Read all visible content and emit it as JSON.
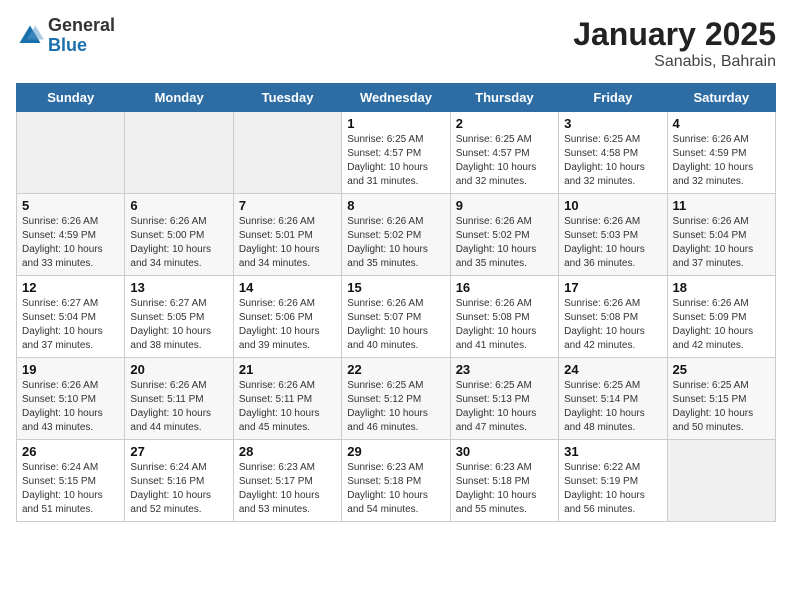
{
  "header": {
    "logo_general": "General",
    "logo_blue": "Blue",
    "title": "January 2025",
    "subtitle": "Sanabis, Bahrain"
  },
  "weekdays": [
    "Sunday",
    "Monday",
    "Tuesday",
    "Wednesday",
    "Thursday",
    "Friday",
    "Saturday"
  ],
  "weeks": [
    [
      {
        "day": "",
        "info": ""
      },
      {
        "day": "",
        "info": ""
      },
      {
        "day": "",
        "info": ""
      },
      {
        "day": "1",
        "info": "Sunrise: 6:25 AM\nSunset: 4:57 PM\nDaylight: 10 hours\nand 31 minutes."
      },
      {
        "day": "2",
        "info": "Sunrise: 6:25 AM\nSunset: 4:57 PM\nDaylight: 10 hours\nand 32 minutes."
      },
      {
        "day": "3",
        "info": "Sunrise: 6:25 AM\nSunset: 4:58 PM\nDaylight: 10 hours\nand 32 minutes."
      },
      {
        "day": "4",
        "info": "Sunrise: 6:26 AM\nSunset: 4:59 PM\nDaylight: 10 hours\nand 32 minutes."
      }
    ],
    [
      {
        "day": "5",
        "info": "Sunrise: 6:26 AM\nSunset: 4:59 PM\nDaylight: 10 hours\nand 33 minutes."
      },
      {
        "day": "6",
        "info": "Sunrise: 6:26 AM\nSunset: 5:00 PM\nDaylight: 10 hours\nand 34 minutes."
      },
      {
        "day": "7",
        "info": "Sunrise: 6:26 AM\nSunset: 5:01 PM\nDaylight: 10 hours\nand 34 minutes."
      },
      {
        "day": "8",
        "info": "Sunrise: 6:26 AM\nSunset: 5:02 PM\nDaylight: 10 hours\nand 35 minutes."
      },
      {
        "day": "9",
        "info": "Sunrise: 6:26 AM\nSunset: 5:02 PM\nDaylight: 10 hours\nand 35 minutes."
      },
      {
        "day": "10",
        "info": "Sunrise: 6:26 AM\nSunset: 5:03 PM\nDaylight: 10 hours\nand 36 minutes."
      },
      {
        "day": "11",
        "info": "Sunrise: 6:26 AM\nSunset: 5:04 PM\nDaylight: 10 hours\nand 37 minutes."
      }
    ],
    [
      {
        "day": "12",
        "info": "Sunrise: 6:27 AM\nSunset: 5:04 PM\nDaylight: 10 hours\nand 37 minutes."
      },
      {
        "day": "13",
        "info": "Sunrise: 6:27 AM\nSunset: 5:05 PM\nDaylight: 10 hours\nand 38 minutes."
      },
      {
        "day": "14",
        "info": "Sunrise: 6:26 AM\nSunset: 5:06 PM\nDaylight: 10 hours\nand 39 minutes."
      },
      {
        "day": "15",
        "info": "Sunrise: 6:26 AM\nSunset: 5:07 PM\nDaylight: 10 hours\nand 40 minutes."
      },
      {
        "day": "16",
        "info": "Sunrise: 6:26 AM\nSunset: 5:08 PM\nDaylight: 10 hours\nand 41 minutes."
      },
      {
        "day": "17",
        "info": "Sunrise: 6:26 AM\nSunset: 5:08 PM\nDaylight: 10 hours\nand 42 minutes."
      },
      {
        "day": "18",
        "info": "Sunrise: 6:26 AM\nSunset: 5:09 PM\nDaylight: 10 hours\nand 42 minutes."
      }
    ],
    [
      {
        "day": "19",
        "info": "Sunrise: 6:26 AM\nSunset: 5:10 PM\nDaylight: 10 hours\nand 43 minutes."
      },
      {
        "day": "20",
        "info": "Sunrise: 6:26 AM\nSunset: 5:11 PM\nDaylight: 10 hours\nand 44 minutes."
      },
      {
        "day": "21",
        "info": "Sunrise: 6:26 AM\nSunset: 5:11 PM\nDaylight: 10 hours\nand 45 minutes."
      },
      {
        "day": "22",
        "info": "Sunrise: 6:25 AM\nSunset: 5:12 PM\nDaylight: 10 hours\nand 46 minutes."
      },
      {
        "day": "23",
        "info": "Sunrise: 6:25 AM\nSunset: 5:13 PM\nDaylight: 10 hours\nand 47 minutes."
      },
      {
        "day": "24",
        "info": "Sunrise: 6:25 AM\nSunset: 5:14 PM\nDaylight: 10 hours\nand 48 minutes."
      },
      {
        "day": "25",
        "info": "Sunrise: 6:25 AM\nSunset: 5:15 PM\nDaylight: 10 hours\nand 50 minutes."
      }
    ],
    [
      {
        "day": "26",
        "info": "Sunrise: 6:24 AM\nSunset: 5:15 PM\nDaylight: 10 hours\nand 51 minutes."
      },
      {
        "day": "27",
        "info": "Sunrise: 6:24 AM\nSunset: 5:16 PM\nDaylight: 10 hours\nand 52 minutes."
      },
      {
        "day": "28",
        "info": "Sunrise: 6:23 AM\nSunset: 5:17 PM\nDaylight: 10 hours\nand 53 minutes."
      },
      {
        "day": "29",
        "info": "Sunrise: 6:23 AM\nSunset: 5:18 PM\nDaylight: 10 hours\nand 54 minutes."
      },
      {
        "day": "30",
        "info": "Sunrise: 6:23 AM\nSunset: 5:18 PM\nDaylight: 10 hours\nand 55 minutes."
      },
      {
        "day": "31",
        "info": "Sunrise: 6:22 AM\nSunset: 5:19 PM\nDaylight: 10 hours\nand 56 minutes."
      },
      {
        "day": "",
        "info": ""
      }
    ]
  ]
}
